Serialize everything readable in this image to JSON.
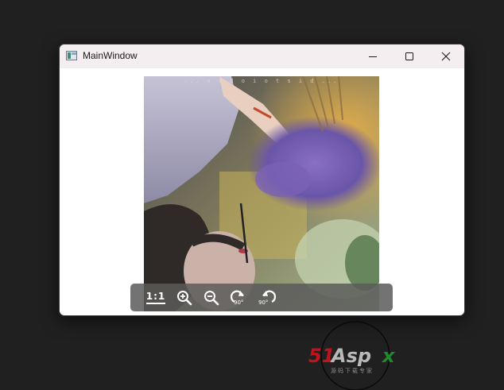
{
  "window": {
    "title": "MainWindow",
    "icon": "app-window-icon",
    "controls": [
      "minimize-icon",
      "maximize-icon",
      "close-icon"
    ]
  },
  "viewer": {
    "image_caption": "... v s d o i o t s i d ...",
    "toolbar": {
      "actual_size_label": "1:1",
      "zoom_in_icon": "zoom-in-icon",
      "zoom_out_icon": "zoom-out-icon",
      "rotate_cw_label": "90°",
      "rotate_ccw_label": "90°"
    }
  },
  "watermark": {
    "text": "51Aspx",
    "subtext": "源码下载专家",
    "colors": {
      "red": "#c0141c",
      "green": "#1e8c2a"
    }
  }
}
